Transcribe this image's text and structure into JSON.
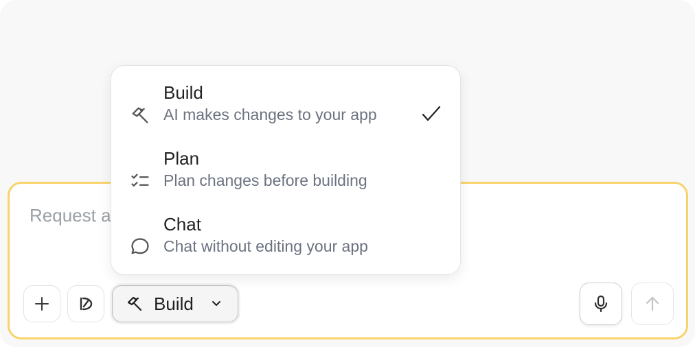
{
  "composer": {
    "placeholder": "Request a",
    "value": ""
  },
  "toolbar": {
    "mode_label": "Build",
    "buttons": {
      "plus": "plus-icon",
      "integrations": "integrations-icon",
      "mic": "microphone-icon",
      "send": "arrow-up-icon"
    }
  },
  "mode_menu": {
    "selected": "Build",
    "items": [
      {
        "title": "Build",
        "description": "AI makes changes to your app",
        "icon": "hammer-icon",
        "selected": true
      },
      {
        "title": "Plan",
        "description": "Plan changes before building",
        "icon": "checklist-icon",
        "selected": false
      },
      {
        "title": "Chat",
        "description": "Chat without editing your app",
        "icon": "chat-bubble-icon",
        "selected": false
      }
    ]
  },
  "colors": {
    "accent_border": "#f8d36b",
    "text_primary": "#222222",
    "text_secondary": "#6b7280",
    "placeholder": "#9aa0a6"
  }
}
